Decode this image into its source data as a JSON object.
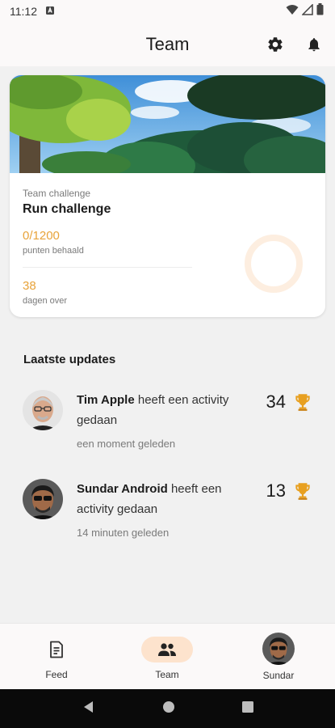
{
  "status_bar": {
    "time": "11:12"
  },
  "app_bar": {
    "title": "Team"
  },
  "challenge": {
    "subtitle": "Team challenge",
    "title": "Run challenge",
    "points": "0/1200",
    "points_label": "punten behaald",
    "days": "38",
    "days_label": "dagen over",
    "progress": 0
  },
  "updates": {
    "title": "Laatste updates",
    "items": [
      {
        "actor": "Tim Apple",
        "action": " heeft een activity gedaan",
        "time": "een moment geleden",
        "points": "34"
      },
      {
        "actor": "Sundar Android",
        "action": " heeft een activity gedaan",
        "time": "14 minuten geleden",
        "points": "13"
      }
    ]
  },
  "bottom_nav": {
    "feed": "Feed",
    "team": "Team",
    "profile": "Sundar"
  },
  "colors": {
    "accent": "#e8a33a",
    "active_pill": "#fde3cd",
    "trophy": "#e8a020"
  }
}
